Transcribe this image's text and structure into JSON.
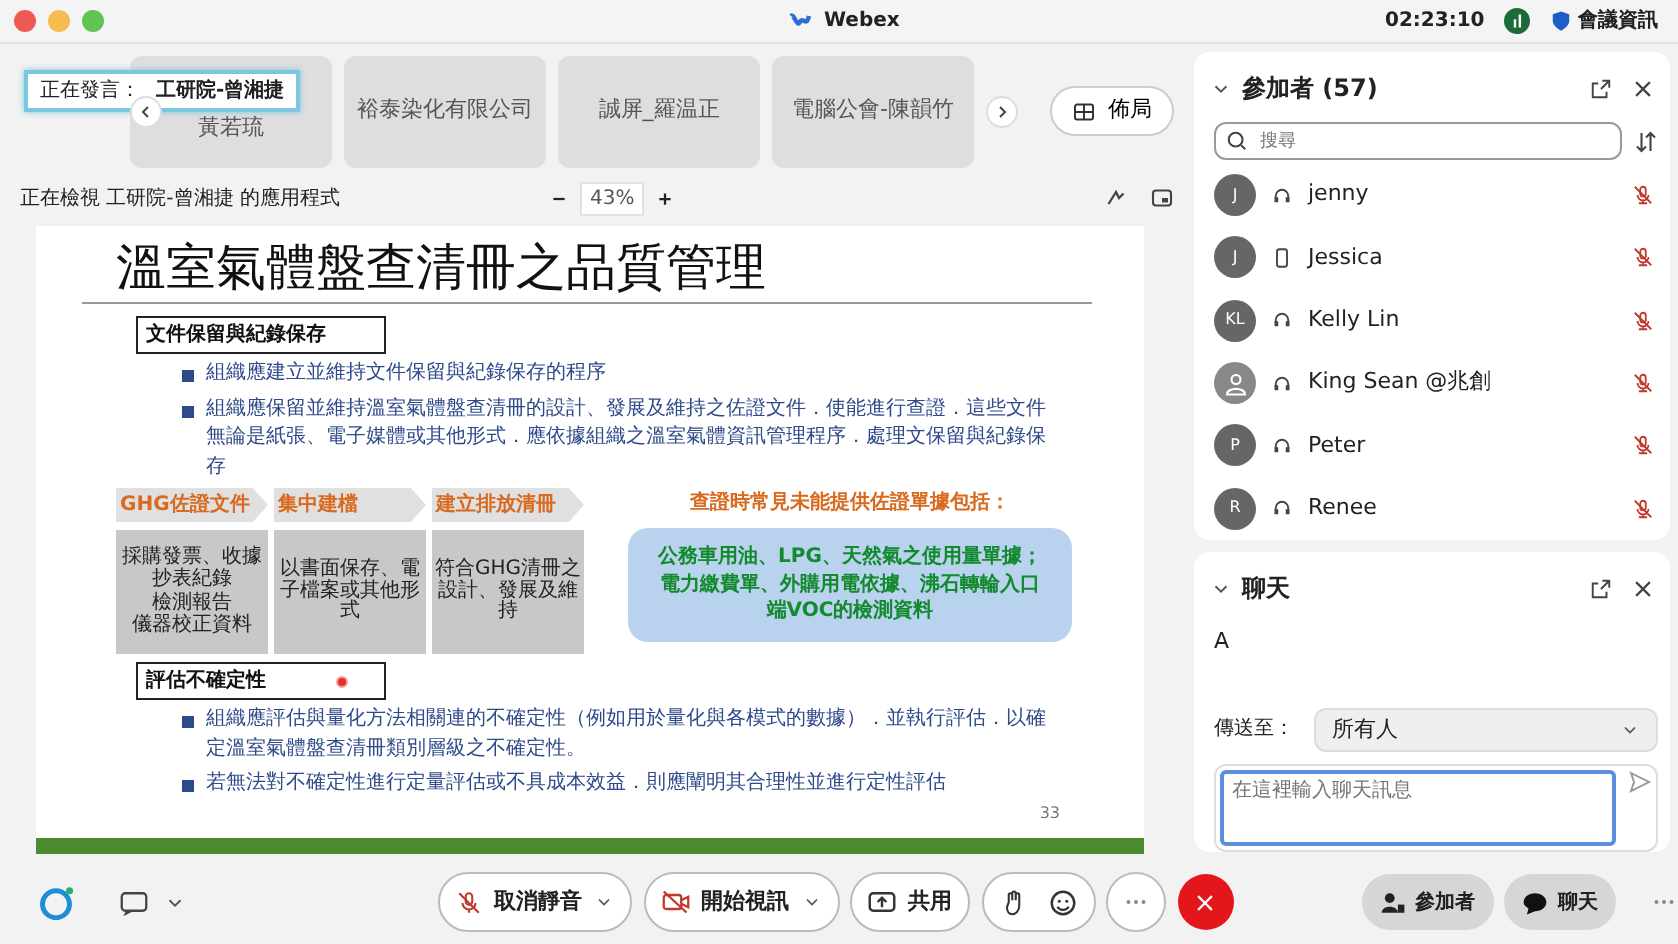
{
  "window": {
    "title": "Webex",
    "time": "02:23:10",
    "meeting_info": "會議資訊"
  },
  "speaker": {
    "label": "正在發言：",
    "name": "工研院-曾湘捷"
  },
  "thumbnails": [
    "黃若琉",
    "裕泰染化有限公司",
    "誠屏_羅温正",
    "電腦公會-陳韻竹"
  ],
  "layout_button": "佈局",
  "viewing": {
    "text": "正在檢視 工研院-曾湘捷 的應用程式",
    "zoom": "43%"
  },
  "slide": {
    "title": "溫室氣體盤查清冊之品質管理",
    "section1": {
      "heading": "文件保留與紀錄保存",
      "bullets": [
        "組織應建立並維持文件保留與紀錄保存的程序",
        "組織應保留並維持溫室氣體盤查清冊的設計、發展及維持之佐證文件．使能進行查證．這些文件無論是紙張、電子媒體或其他形式．應依據組織之溫室氣體資訊管理程序．處理文保留與紀錄保存"
      ]
    },
    "steps": [
      {
        "label": "GHG佐證文件",
        "detail": [
          "採購發票、收據",
          "抄表紀錄",
          "檢測報告",
          "儀器校正資料"
        ]
      },
      {
        "label": "集中建檔",
        "detail": [
          "以書面保存、電子檔案或其他形式"
        ]
      },
      {
        "label": "建立排放清冊",
        "detail": [
          "符合GHG清冊之設計、發展及維持"
        ]
      }
    ],
    "callout": {
      "heading": "查證時常見未能提供佐證單據包括：",
      "text": "公務車用油、LPG、天然氣之使用量單據；電力繳費單、外購用電依據、沸石轉輪入口端VOC的檢測資料"
    },
    "section2": {
      "heading": "評估不確定性",
      "bullets": [
        "組織應評估與量化方法相關連的不確定性（例如用於量化與各模式的數據）．並執行評估．以確定溫室氣體盤查清冊類別層級之不確定性。",
        "若無法對不確定性進行定量評估或不具成本效益．則應闡明其合理性並進行定性評估"
      ]
    },
    "page_number": "33"
  },
  "participants": {
    "title": "參加者 (57)",
    "search_placeholder": "搜尋",
    "people": [
      {
        "kind": "initials",
        "initials": "J",
        "device": {
          "kind": "headset"
        },
        "name": "jenny",
        "muted": true
      },
      {
        "kind": "initials",
        "initials": "J",
        "device": {
          "kind": "phone"
        },
        "name": "Jessica",
        "muted": true
      },
      {
        "kind": "initials",
        "initials": "KL",
        "device": {
          "kind": "headset"
        },
        "name": "Kelly Lin",
        "muted": true
      },
      {
        "kind": "silhouette",
        "device": {
          "kind": "headset"
        },
        "name": "King Sean @兆創",
        "muted": true
      },
      {
        "kind": "initials",
        "initials": "P",
        "device": {
          "kind": "headset"
        },
        "name": "Peter",
        "muted": true
      },
      {
        "kind": "initials",
        "initials": "R",
        "device": {
          "kind": "headset"
        },
        "name": "Renee",
        "muted": true
      }
    ]
  },
  "chat": {
    "title": "聊天",
    "messages": [
      "A"
    ],
    "send_to_label": "傳送至：",
    "send_to": "所有人",
    "placeholder": "在這裡輸入聊天訊息"
  },
  "toolbar": {
    "mute": "取消靜音",
    "video": "開始視訊",
    "share": "共用",
    "participants": "參加者",
    "chat": "聊天"
  }
}
